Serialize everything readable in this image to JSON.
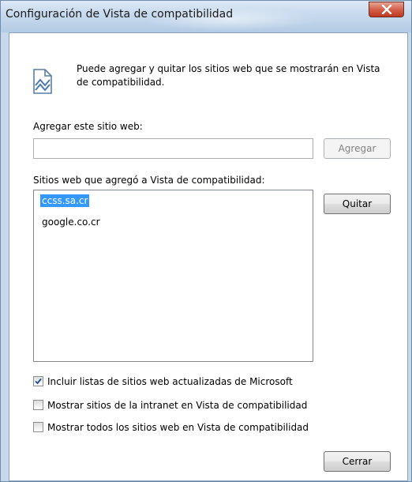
{
  "window": {
    "title": "Configuración de Vista de compatibilidad"
  },
  "info": {
    "icon": "compatibility-view-icon",
    "text": "Puede agregar y quitar los sitios web que se mostrarán en Vista de compatibilidad."
  },
  "add_site": {
    "label": "Agregar este sitio web:",
    "value": "",
    "placeholder": "",
    "button_label": "Agregar",
    "button_enabled": false
  },
  "sites": {
    "label": "Sitios web que agregó a Vista de compatibilidad:",
    "items": [
      "ccss.sa.cr",
      "google.co.cr"
    ],
    "selected_index": 0,
    "remove_button_label": "Quitar"
  },
  "options": [
    {
      "label": "Incluir listas de sitios web actualizadas de Microsoft",
      "checked": true
    },
    {
      "label": "Mostrar sitios de la intranet en Vista de compatibilidad",
      "checked": false
    },
    {
      "label": "Mostrar todos los sitios web en Vista de compatibilidad",
      "checked": false
    }
  ],
  "close_button_label": "Cerrar",
  "colors": {
    "selection": "#3399ff",
    "close_button": "#c0391f"
  }
}
